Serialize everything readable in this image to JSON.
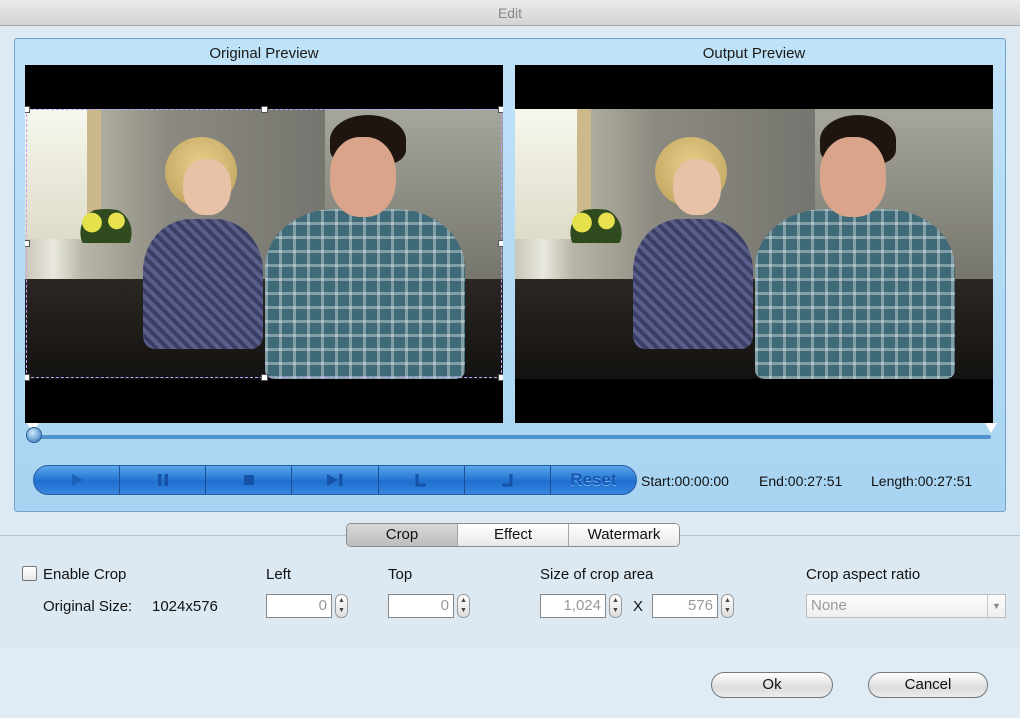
{
  "window": {
    "title": "Edit"
  },
  "preview": {
    "original_title": "Original Preview",
    "output_title": "Output Preview"
  },
  "controls": {
    "reset_label": "Reset",
    "start": "Start:00:00:00",
    "end": "End:00:27:51",
    "length": "Length:00:27:51",
    "timeline_position": 0
  },
  "tabs": [
    {
      "label": "Crop",
      "active": true
    },
    {
      "label": "Effect",
      "active": false
    },
    {
      "label": "Watermark",
      "active": false
    }
  ],
  "crop": {
    "enable_label": "Enable Crop",
    "enabled": false,
    "original_size_label": "Original Size:",
    "original_size_value": "1024x576",
    "left_label": "Left",
    "left_value": "0",
    "top_label": "Top",
    "top_value": "0",
    "size_label": "Size of crop area",
    "width_value": "1,024",
    "x_sep": "X",
    "height_value": "576",
    "aspect_label": "Crop aspect ratio",
    "aspect_value": "None"
  },
  "buttons": {
    "ok": "Ok",
    "cancel": "Cancel"
  },
  "icons": {
    "play": "play-icon",
    "pause": "pause-icon",
    "stop": "stop-icon",
    "next_frame": "next-frame-icon",
    "set_start": "set-start-icon",
    "set_end": "set-end-icon"
  }
}
